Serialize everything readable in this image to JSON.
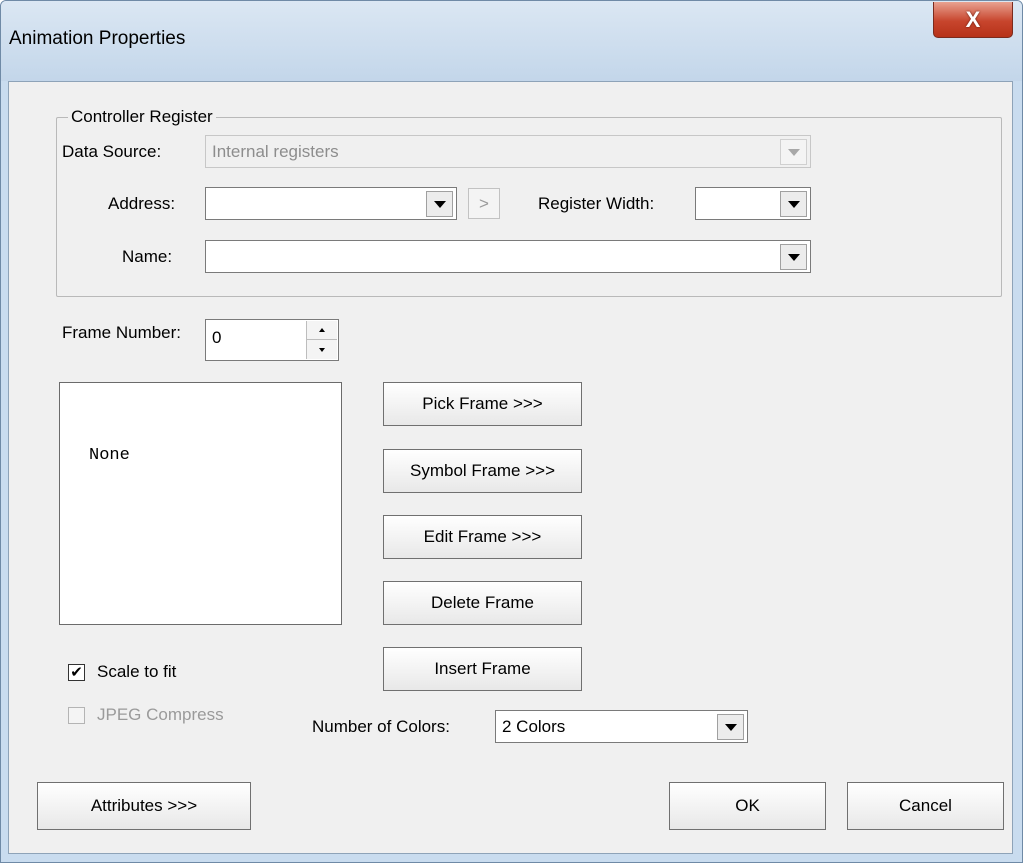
{
  "window": {
    "title": "Animation Properties",
    "close_glyph": "X"
  },
  "controller_register": {
    "legend": "Controller Register",
    "data_source_label": "Data Source:",
    "data_source_value": "Internal registers",
    "address_label": "Address:",
    "address_value": "",
    "address_go_glyph": ">",
    "register_width_label": "Register Width:",
    "register_width_value": "",
    "name_label": "Name:",
    "name_value": ""
  },
  "frame": {
    "frame_number_label": "Frame Number:",
    "frame_number_value": "0",
    "preview_text": "None"
  },
  "frame_buttons": {
    "pick": "Pick Frame >>>",
    "symbol": "Symbol Frame >>>",
    "edit": "Edit Frame >>>",
    "delete": "Delete Frame",
    "insert": "Insert Frame"
  },
  "options": {
    "scale_to_fit_label": "Scale to fit",
    "scale_to_fit_checked": true,
    "jpeg_compress_label": "JPEG Compress",
    "jpeg_compress_checked": false,
    "number_of_colors_label": "Number of Colors:",
    "number_of_colors_value": "2 Colors"
  },
  "footer": {
    "attributes": "Attributes >>>",
    "ok": "OK",
    "cancel": "Cancel"
  }
}
